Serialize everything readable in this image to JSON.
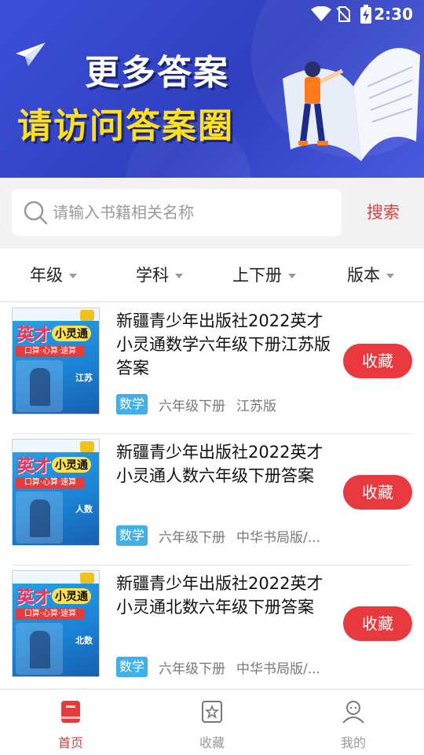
{
  "status_bar": {
    "time": "2:30"
  },
  "banner": {
    "line1": "更多答案",
    "line2": "请访问答案圈",
    "line1_color": "#ffffff",
    "line2_color": "#ffe11a",
    "background_color": "#3646d2"
  },
  "search": {
    "placeholder": "请输入书籍相关名称",
    "value": "",
    "button_label": "搜索"
  },
  "filters": [
    {
      "label": "年级"
    },
    {
      "label": "学科"
    },
    {
      "label": "上下册"
    },
    {
      "label": "版本"
    }
  ],
  "books": [
    {
      "title": "新疆青少年出版社2022英才小灵通数学六年级下册江苏版答案",
      "subject": "数学",
      "grade": "六年级下册",
      "edition": "江苏版",
      "cover": {
        "title": "英才",
        "subtitle": "小灵通",
        "band": "口算·心算·速算",
        "edition_mark": "江苏"
      },
      "fav_label": "收藏"
    },
    {
      "title": "新疆青少年出版社2022英才小灵通人数六年级下册答案",
      "subject": "数学",
      "grade": "六年级下册",
      "edition": "中华书局版/...",
      "cover": {
        "title": "英才",
        "subtitle": "小灵通",
        "band": "口算·心算·速算",
        "edition_mark": "人数"
      },
      "fav_label": "收藏"
    },
    {
      "title": "新疆青少年出版社2022英才小灵通北数六年级下册答案",
      "subject": "数学",
      "grade": "六年级下册",
      "edition": "中华书局版/...",
      "cover": {
        "title": "英才",
        "subtitle": "小灵通",
        "band": "口算·心算·速算",
        "edition_mark": "北数"
      },
      "fav_label": "收藏"
    }
  ],
  "bottom_nav": [
    {
      "label": "首页",
      "icon": "book-icon",
      "active": true
    },
    {
      "label": "收藏",
      "icon": "star-box-icon",
      "active": false
    },
    {
      "label": "我的",
      "icon": "person-icon",
      "active": false
    }
  ],
  "colors": {
    "accent": "#e23c3c",
    "tag_blue": "#41b0e8",
    "fav_button": "#e8393f"
  }
}
